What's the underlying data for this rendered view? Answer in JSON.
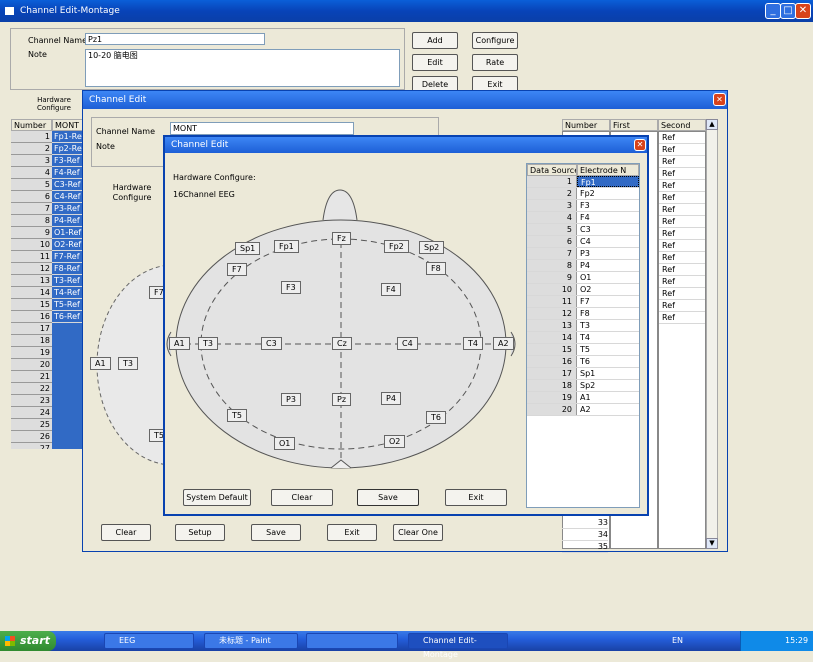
{
  "main_window": {
    "title": "Channel Edit-Montage",
    "channel_name_label": "Channel Name",
    "channel_name_value": "Pz1",
    "note_label": "Note",
    "note_value": "10-20 脑电图",
    "buttons": {
      "add": "Add",
      "configure": "Configure",
      "edit": "Edit",
      "rate": "Rate",
      "delete": "Delete",
      "exit": "Exit"
    },
    "tab_hardware": "Hardware Configure",
    "col_number": "Number",
    "col_mont": "MONT",
    "rows_mont": [
      "Fp1-Ref",
      "Fp2-Ref",
      "F3-Ref",
      "F4-Ref",
      "C3-Ref",
      "C4-Ref",
      "P3-Ref",
      "P4-Ref",
      "O1-Ref",
      "O2-Ref",
      "F7-Ref",
      "F8-Ref",
      "T3-Ref",
      "T4-Ref",
      "T5-Ref",
      "T6-Ref"
    ],
    "numbers": [
      "1",
      "2",
      "3",
      "4",
      "5",
      "6",
      "7",
      "8",
      "9",
      "10",
      "11",
      "12",
      "13",
      "14",
      "15",
      "16",
      "17",
      "18",
      "19",
      "20",
      "21",
      "22",
      "23",
      "24",
      "25",
      "26",
      "27",
      "28",
      "29",
      "30",
      "31",
      "32"
    ]
  },
  "channel_edit": {
    "title": "Channel Edit",
    "channel_name_label": "Channel Name",
    "channel_name_value": "MONT",
    "note_label": "Note",
    "tab_hardware": "Hardware Configure",
    "col_number": "Number",
    "col_first": "First",
    "col_second": "Second",
    "second_values": [
      "Ref",
      "Ref",
      "Ref",
      "Ref",
      "Ref",
      "Ref",
      "Ref",
      "Ref",
      "Ref",
      "Ref",
      "Ref",
      "Ref",
      "Ref",
      "Ref",
      "Ref",
      "Ref"
    ],
    "bottom_numbers": [
      "33",
      "34",
      "35"
    ],
    "buttons": {
      "clear": "Clear",
      "setup": "Setup",
      "save": "Save",
      "exit": "Exit",
      "clear_one": "Clear One"
    },
    "bg_electrodes": {
      "f7": "F7",
      "a1": "A1",
      "t3": "T3",
      "t5": "T5"
    }
  },
  "inner_dialog": {
    "title": "Channel Edit",
    "hardware_label": "Hardware Configure:",
    "hardware_value": "16Channel EEG",
    "col_data_source": "Data Source",
    "col_electrode": "Electrode N",
    "sources": [
      {
        "n": "1",
        "e": "Fp1"
      },
      {
        "n": "2",
        "e": "Fp2"
      },
      {
        "n": "3",
        "e": "F3"
      },
      {
        "n": "4",
        "e": "F4"
      },
      {
        "n": "5",
        "e": "C3"
      },
      {
        "n": "6",
        "e": "C4"
      },
      {
        "n": "7",
        "e": "P3"
      },
      {
        "n": "8",
        "e": "P4"
      },
      {
        "n": "9",
        "e": "O1"
      },
      {
        "n": "10",
        "e": "O2"
      },
      {
        "n": "11",
        "e": "F7"
      },
      {
        "n": "12",
        "e": "F8"
      },
      {
        "n": "13",
        "e": "T3"
      },
      {
        "n": "14",
        "e": "T4"
      },
      {
        "n": "15",
        "e": "T5"
      },
      {
        "n": "16",
        "e": "T6"
      },
      {
        "n": "17",
        "e": "Sp1"
      },
      {
        "n": "18",
        "e": "Sp2"
      },
      {
        "n": "19",
        "e": "A1"
      },
      {
        "n": "20",
        "e": "A2"
      }
    ],
    "electrodes": {
      "sp1": "Sp1",
      "fp1": "Fp1",
      "fz": "Fz",
      "fp2": "Fp2",
      "sp2": "Sp2",
      "f7": "F7",
      "f8": "F8",
      "f3": "F3",
      "f4": "F4",
      "a1": "A1",
      "t3": "T3",
      "c3": "C3",
      "cz": "Cz",
      "c4": "C4",
      "t4": "T4",
      "a2": "A2",
      "p3": "P3",
      "pz": "Pz",
      "p4": "P4",
      "t5": "T5",
      "t6": "T6",
      "o1": "O1",
      "o2": "O2"
    },
    "buttons": {
      "system_default": "System Default",
      "clear": "Clear",
      "save": "Save",
      "exit": "Exit"
    }
  },
  "taskbar": {
    "start": "start",
    "tasks": [
      "EEG",
      "未标题 - Paint",
      "",
      "Channel Edit-Montage"
    ],
    "lang": "EN",
    "clock": "15:29"
  }
}
